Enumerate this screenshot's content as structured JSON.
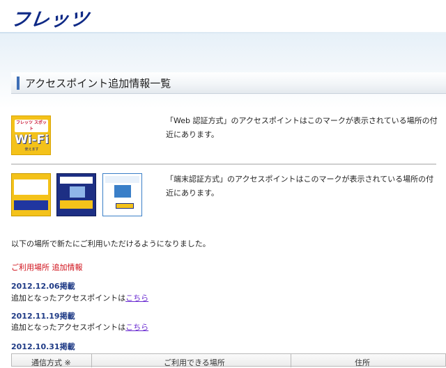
{
  "header": {
    "logo": "フレッツ"
  },
  "page": {
    "title": "アクセスポイント追加情報一覧"
  },
  "marks": {
    "wifi": {
      "top": "フレッツ スポット",
      "main": "Wi-Fi",
      "bottom": "使えます"
    },
    "web_desc": "「Web 認証方式」のアクセスポイントはこのマークが表示されている場所の付近にあります。",
    "terminal_desc": "「端末認証方式」のアクセスポイントはこのマークが表示されている場所の付近にあります。"
  },
  "intro": "以下の場所で新たにご利用いただけるようになりました。",
  "section_heading": "ご利用場所 追加情報",
  "updates": [
    {
      "date": "2012.12.06掲載",
      "text": "追加となったアクセスポイントは",
      "link": "こちら"
    },
    {
      "date": "2012.11.19掲載",
      "text": "追加となったアクセスポイントは",
      "link": "こちら"
    },
    {
      "date": "2012.10.31掲載"
    }
  ],
  "table": {
    "headers": [
      "通信方式 ※",
      "ご利用できる場所",
      "住所"
    ]
  }
}
